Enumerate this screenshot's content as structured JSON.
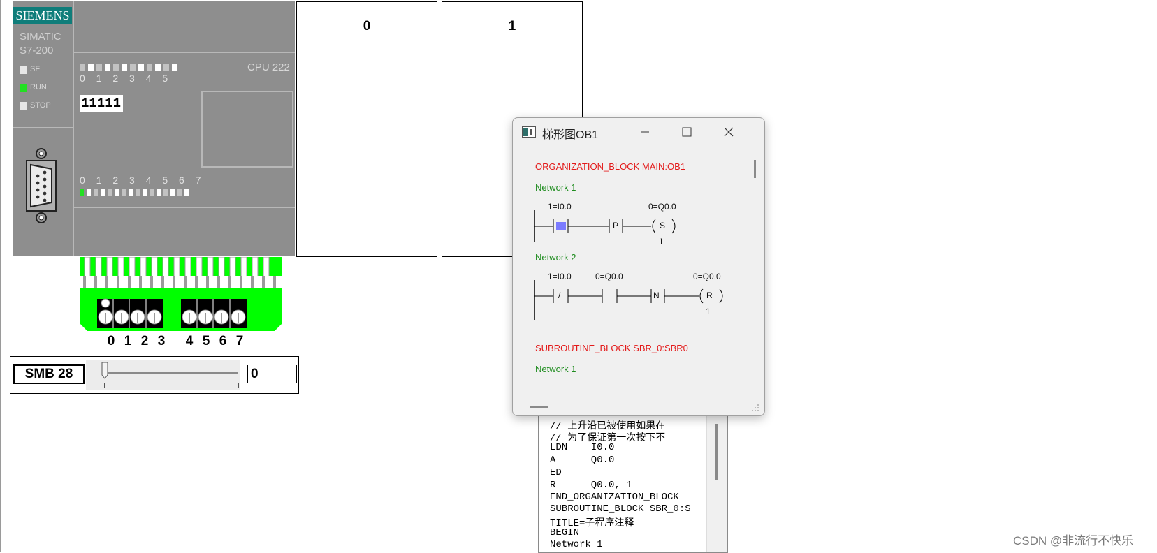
{
  "plc": {
    "brand": "SIEMENS",
    "line1": "SIMATIC",
    "line2": "S7-200",
    "status_leds": [
      {
        "label": "SF",
        "state": "off"
      },
      {
        "label": "RUN",
        "state": "on"
      },
      {
        "label": "STOP",
        "state": "off"
      }
    ],
    "cpu_model": "CPU 222",
    "output_numbers": "0 1 2 3 4 5",
    "input_numbers": "0 1 2 3 4 5 6 7",
    "mode_display": "11111",
    "output_led_states": [
      "off",
      "on",
      "off",
      "on",
      "off",
      "on",
      "off",
      "on",
      "off",
      "on",
      "off",
      "on"
    ],
    "input_led_states": [
      "on",
      "on",
      "off",
      "on",
      "off",
      "on",
      "off",
      "on",
      "off",
      "on",
      "off",
      "on",
      "off",
      "on",
      "off",
      "on"
    ]
  },
  "output_boxes": [
    {
      "label": "0"
    },
    {
      "label": "1"
    }
  ],
  "input_switches": {
    "labels": [
      "0",
      "1",
      "2",
      "3",
      "4",
      "5",
      "6",
      "7"
    ],
    "states": [
      "on",
      "off",
      "off",
      "off",
      "off",
      "off",
      "off",
      "off"
    ]
  },
  "analog": {
    "label": "SMB 28",
    "value": "0"
  },
  "ladder_window": {
    "title": "梯形图OB1",
    "header_main": "ORGANIZATION_BLOCK MAIN:OB1",
    "network1_title": "Network 1",
    "n1_contact1_label": "1=I0.0",
    "n1_coil_label": "0=Q0.0",
    "n1_p_label": "P",
    "n1_coil_text": "S",
    "n1_coil_count": "1",
    "network2_title": "Network 2",
    "n2_contact1_label": "1=I0.0",
    "n2_contact2_label": "0=Q0.0",
    "n2_coil_label": "0=Q0.0",
    "n2_contact1_text": "/",
    "n2_n_label": "N",
    "n2_coil_text": "R",
    "n2_coil_count": "1",
    "header_sub": "SUBROUTINE_BLOCK SBR_0:SBR0",
    "sub_network1_title": "Network 1"
  },
  "stl_lines": [
    "// 上升沿已被使用如果在",
    "// 为了保证第一次按下不",
    "LDN    I0.0",
    "A      Q0.0",
    "ED",
    "R      Q0.0, 1",
    "END_ORGANIZATION_BLOCK",
    "SUBROUTINE_BLOCK SBR_0:S",
    "TITLE=子程序注释",
    "BEGIN",
    "Network 1"
  ],
  "watermark": "CSDN @非流行不快乐",
  "colors": {
    "plc_body": "#8e8e8e",
    "siemens_teal": "#0f7d7a",
    "led_green": "#22e022",
    "terminal_green": "#00ff00",
    "ladder_red": "#e31a1a",
    "ladder_green": "#1e8c1e",
    "contact_blue": "#7b7bff"
  }
}
